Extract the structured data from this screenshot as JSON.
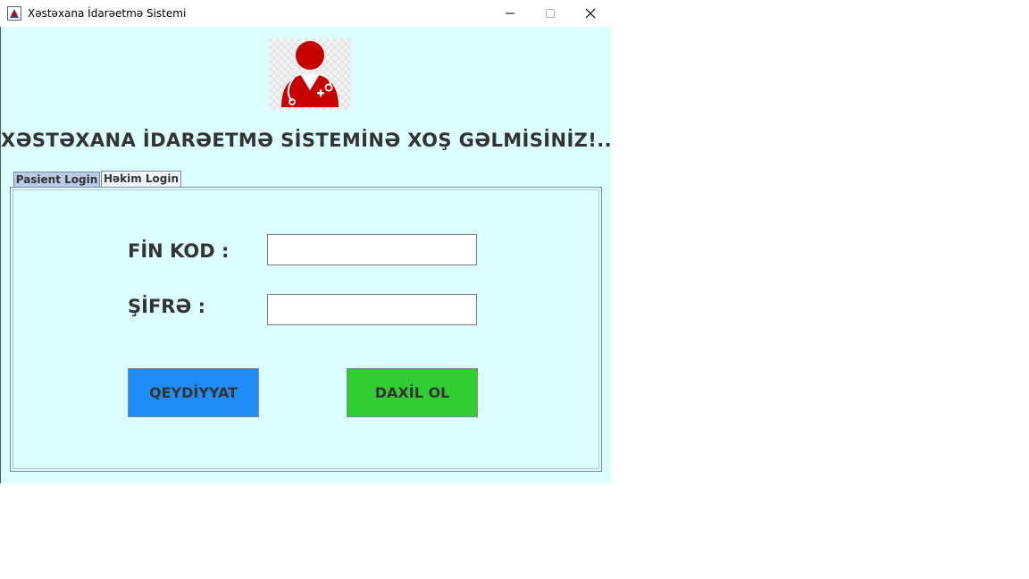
{
  "window": {
    "title": "Xəstəxana İdarəetmə Sistemi"
  },
  "titlebar": {
    "icons": [
      "app-icon",
      "minimize-icon",
      "maximize-icon",
      "close-icon"
    ]
  },
  "main": {
    "logo_icon": "doctor-avatar-icon",
    "heading": "XƏSTƏXANA İDARƏETMƏ SİSTEMİNƏ XOŞ GƏLMİSİNİZ!..",
    "tabs": [
      {
        "label": "Pasient Login",
        "selected": true
      },
      {
        "label": "Həkim Login",
        "selected": false
      }
    ],
    "form": {
      "fin_label": "FİN KOD :",
      "fin_value": "",
      "password_label": "ŞİFRƏ :",
      "password_value": "",
      "register_label": "QEYDİYYAT",
      "login_label": "DAXİL OL"
    }
  },
  "colors": {
    "background": "#ddfefe",
    "register_button": "#1f8cf7",
    "login_button": "#32cd32",
    "logo_red": "#c40000"
  }
}
